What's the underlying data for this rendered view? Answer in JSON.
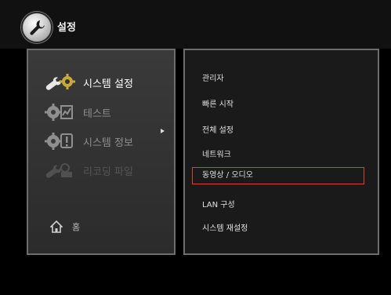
{
  "header": {
    "title": "설정",
    "icon": "wrench-icon"
  },
  "left_menu": {
    "items": [
      {
        "label": "시스템 설정",
        "icon": "wrench-gear-icon",
        "state": "active"
      },
      {
        "label": "테스트",
        "icon": "gear-chart-icon",
        "state": "normal"
      },
      {
        "label": "시스템 정보",
        "icon": "gear-exclamation-icon",
        "state": "normal"
      },
      {
        "label": "리코딩 파일",
        "icon": "wrench-camera-icon",
        "state": "disabled"
      }
    ],
    "home": {
      "label": "홈",
      "icon": "home-icon"
    }
  },
  "submenu": {
    "items": [
      {
        "label": "관리자"
      },
      {
        "label": "빠른 시작"
      },
      {
        "label": "전체 설정"
      },
      {
        "label": "네트워크"
      },
      {
        "label": "동영상 / 오디오",
        "selected": true
      },
      {
        "label": "LAN 구성"
      },
      {
        "label": "시스템 재설정"
      }
    ]
  },
  "colors": {
    "selection_border": "#d9432b",
    "panel_border": "#6d6d6d"
  }
}
